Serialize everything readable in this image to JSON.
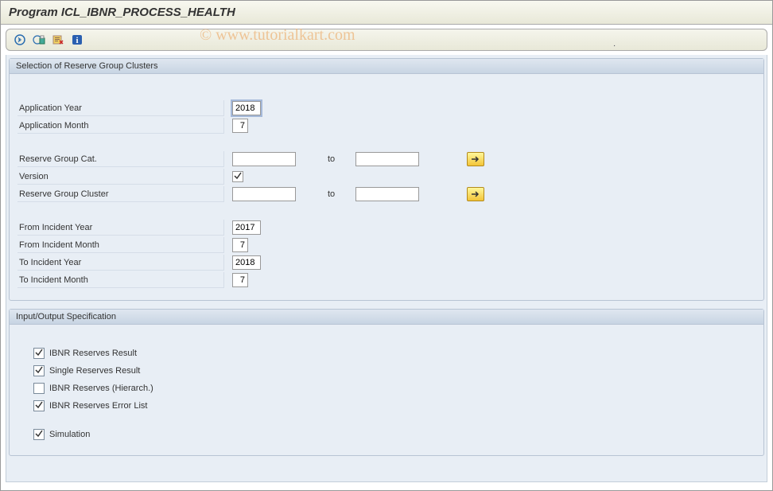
{
  "title": "Program ICL_IBNR_PROCESS_HEALTH",
  "watermark": "© www.tutorialkart.com",
  "toolbar": {
    "icons": [
      "execute-icon",
      "execute-print-icon",
      "variant-icon",
      "info-icon"
    ]
  },
  "group1": {
    "title": "Selection of Reserve Group Clusters",
    "fields": {
      "app_year": {
        "label": "Application Year",
        "value": "2018"
      },
      "app_month": {
        "label": "Application Month",
        "value": "7"
      },
      "res_cat": {
        "label": "Reserve Group Cat.",
        "from": "",
        "to_label": "to",
        "to": ""
      },
      "version": {
        "label": "Version",
        "value": "checked"
      },
      "res_cluster": {
        "label": "Reserve Group Cluster",
        "from": "",
        "to_label": "to",
        "to": ""
      },
      "from_year": {
        "label": "From Incident Year",
        "value": "2017"
      },
      "from_month": {
        "label": "From Incident Month",
        "value": "7"
      },
      "to_year": {
        "label": "To Incident Year",
        "value": "2018"
      },
      "to_month": {
        "label": "To Incident Month",
        "value": "7"
      }
    }
  },
  "group2": {
    "title": "Input/Output Specification",
    "checkboxes": {
      "ibnr_result": {
        "label": "IBNR Reserves Result",
        "checked": true
      },
      "single_result": {
        "label": "Single Reserves Result",
        "checked": true
      },
      "ibnr_hier": {
        "label": "IBNR Reserves (Hierarch.)",
        "checked": false
      },
      "ibnr_error": {
        "label": "IBNR Reserves Error List",
        "checked": true
      },
      "simulation": {
        "label": "Simulation",
        "checked": true
      }
    }
  }
}
